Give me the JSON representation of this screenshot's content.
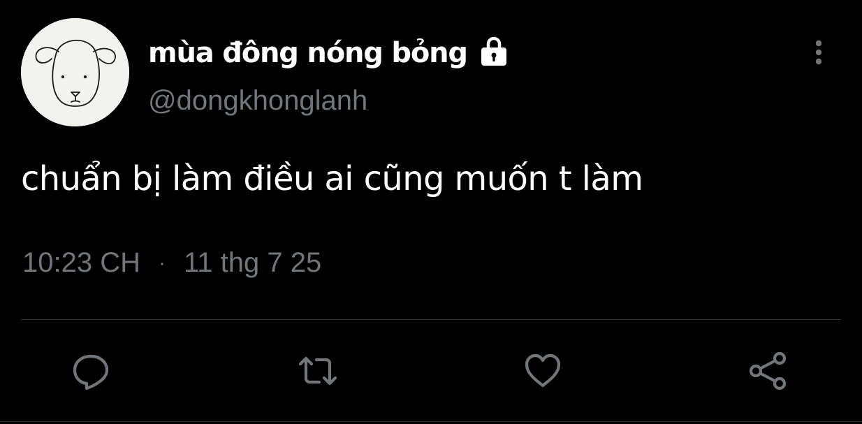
{
  "tweet": {
    "display_name": "mùa đông nóng bỏng",
    "handle": "@dongkhonglanh",
    "text": "chuẩn bị làm điều ai cũng muốn t làm",
    "time": "10:23 CH",
    "separator": "·",
    "date": "11 thg 7 25"
  },
  "icons": {
    "protected": "lock-icon",
    "more": "more-vertical-icon",
    "reply": "reply-icon",
    "retweet": "retweet-icon",
    "like": "heart-icon",
    "share": "share-icon"
  },
  "colors": {
    "background": "#000000",
    "primary_text": "#ffffff",
    "secondary_text": "#71767b",
    "divider": "#2f3336",
    "icon": "#71767b"
  }
}
